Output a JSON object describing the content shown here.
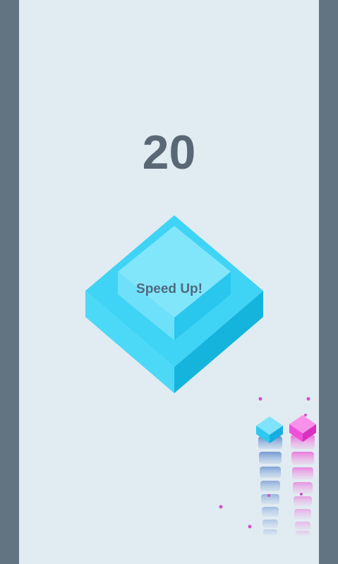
{
  "game": {
    "score": "20",
    "message": "Speed Up!"
  },
  "colors": {
    "background": "#e1ebf2",
    "side_bars": "#627382",
    "score_text": "#5a6875",
    "platform_top": "#82e6fb",
    "platform_side": "#1fc4ec",
    "player_blue": "#2ec9f0",
    "player_pink": "#f04fd8"
  },
  "icons": {
    "platform": "isometric-stepped-platform-icon",
    "blue_player": "blue-cube-icon",
    "pink_player": "pink-cube-icon"
  }
}
